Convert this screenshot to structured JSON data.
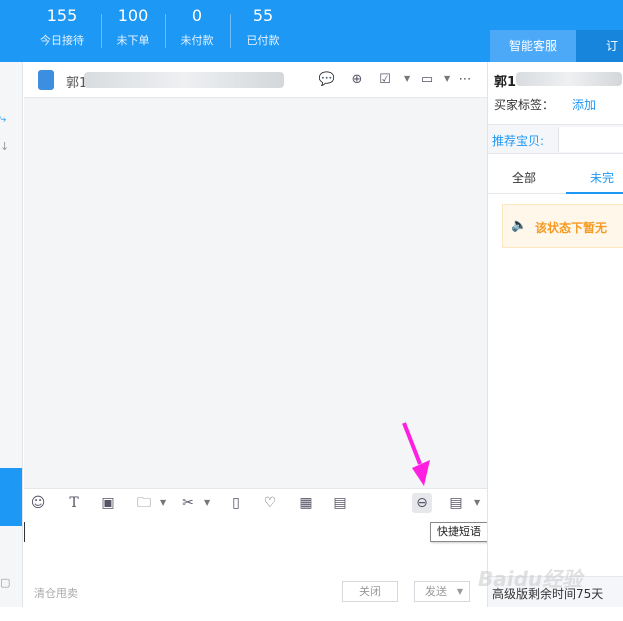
{
  "stats": [
    {
      "value": "155",
      "label": "今日接待"
    },
    {
      "value": "100",
      "label": "未下单"
    },
    {
      "value": "0",
      "label": "未付款"
    },
    {
      "value": "55",
      "label": "已付款"
    }
  ],
  "top_tabs": [
    {
      "label": "智能客服"
    },
    {
      "label": "订单"
    }
  ],
  "chat": {
    "contact_name": "郭1",
    "input_placeholder": "清仓甩卖",
    "close_label": "关闭",
    "send_label": "发送"
  },
  "toolbar": {
    "tooltip": "快捷短语",
    "icons": [
      "emoji-icon",
      "font-icon",
      "image-icon",
      "folder-icon",
      "scissors-icon",
      "vibrate-icon",
      "heart-icon",
      "calculator-icon",
      "save-icon",
      "quick-phrase-icon",
      "history-icon"
    ]
  },
  "right_panel": {
    "customer_name": "郭1",
    "tag_label": "买家标签：",
    "tag_add": "添加",
    "recommend_label": "推荐宝贝:",
    "tabs": [
      {
        "label": "全部"
      },
      {
        "label": "未完"
      }
    ],
    "notice": "该状态下暂无",
    "footer": "高级版剩余时间75天"
  },
  "watermark": "Baidu经验",
  "colors": {
    "brand_blue": "#1e98f5",
    "notice_orange": "#f59a23",
    "annotation_magenta": "#ff1fe0"
  }
}
